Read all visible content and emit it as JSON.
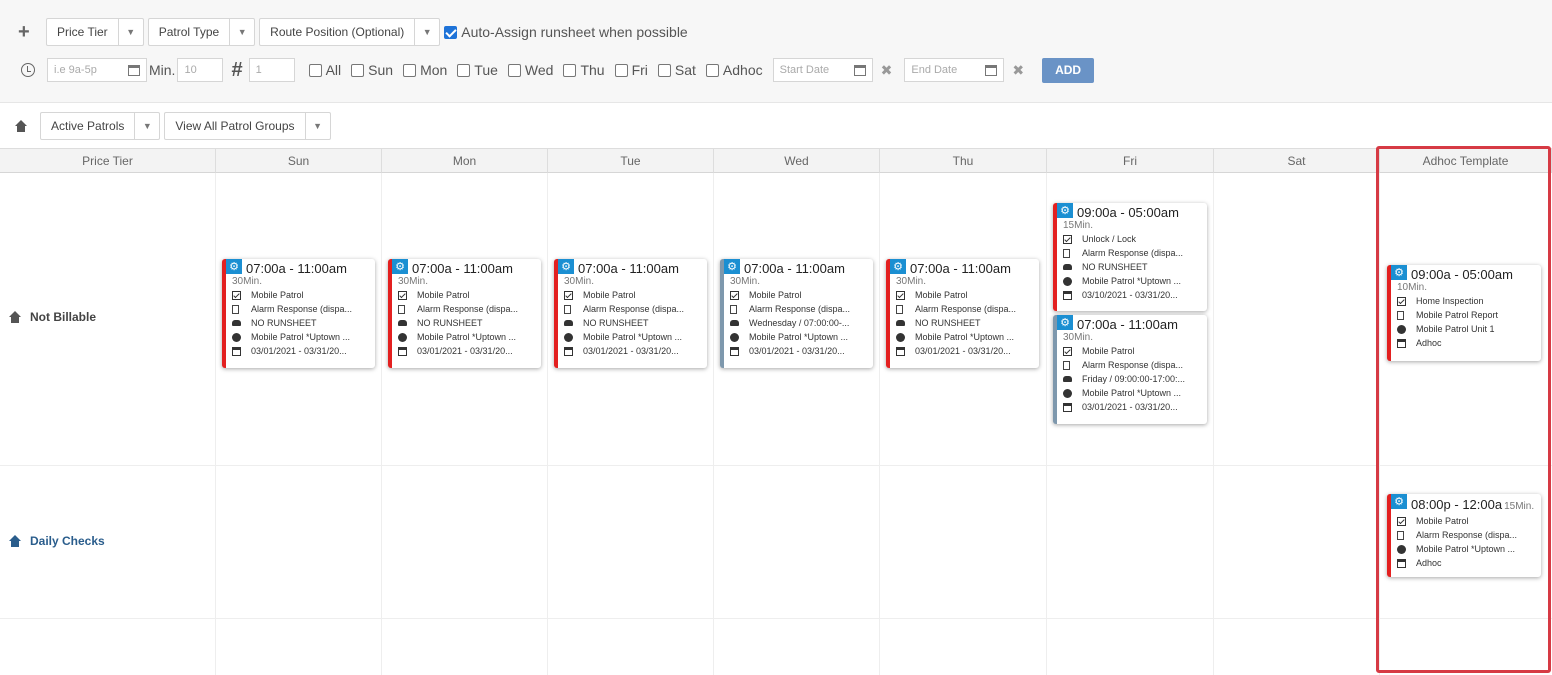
{
  "toolbar": {
    "add_icon": "plus-icon",
    "price_tier": "Price Tier",
    "patrol_type": "Patrol Type",
    "route_position": "Route Position (Optional)",
    "auto_assign": "Auto-Assign runsheet when possible",
    "time_placeholder": "i.e 9a-5p",
    "min_label": "Min.",
    "min_value": "10",
    "count_value": "1",
    "days": [
      "All",
      "Sun",
      "Mon",
      "Tue",
      "Wed",
      "Thu",
      "Fri",
      "Sat",
      "Adhoc"
    ],
    "start_date": "Start Date",
    "end_date": "End Date",
    "add_label": "ADD"
  },
  "filters": {
    "active": "Active Patrols",
    "groups": "View All Patrol Groups"
  },
  "grid": {
    "headers": [
      "Price Tier",
      "Sun",
      "Mon",
      "Tue",
      "Wed",
      "Thu",
      "Fri",
      "Sat",
      "Adhoc Template"
    ],
    "rows": [
      "Not Billable",
      "Daily Checks"
    ]
  },
  "colors": {
    "red_bar": "#e32020",
    "grey_bar": "#7e98ad",
    "gear_blue": "#1b8fd2",
    "highlight": "#d63a44",
    "add_button": "#6a93c6"
  },
  "cards": [
    {
      "time": "07:00a - 11:00am",
      "min": "30Min.",
      "lines": [
        "Mobile Patrol",
        "Alarm Response (dispa...",
        "NO RUNSHEET",
        "Mobile Patrol *Uptown ...",
        "03/01/2021 - 03/31/20..."
      ]
    },
    {
      "time": "07:00a - 11:00am",
      "min": "30Min.",
      "lines": [
        "Mobile Patrol",
        "Alarm Response (dispa...",
        "NO RUNSHEET",
        "Mobile Patrol *Uptown ...",
        "03/01/2021 - 03/31/20..."
      ]
    },
    {
      "time": "07:00a - 11:00am",
      "min": "30Min.",
      "lines": [
        "Mobile Patrol",
        "Alarm Response (dispa...",
        "NO RUNSHEET",
        "Mobile Patrol *Uptown ...",
        "03/01/2021 - 03/31/20..."
      ]
    },
    {
      "time": "07:00a - 11:00am",
      "min": "30Min.",
      "lines": [
        "Mobile Patrol",
        "Alarm Response (dispa...",
        "Wednesday / 07:00:00-...",
        "Mobile Patrol *Uptown ...",
        "03/01/2021 - 03/31/20..."
      ]
    },
    {
      "time": "07:00a - 11:00am",
      "min": "30Min.",
      "lines": [
        "Mobile Patrol",
        "Alarm Response (dispa...",
        "NO RUNSHEET",
        "Mobile Patrol *Uptown ...",
        "03/01/2021 - 03/31/20..."
      ]
    },
    {
      "time": "09:00a - 05:00am",
      "min": "15Min.",
      "lines": [
        "Unlock / Lock",
        "Alarm Response (dispa...",
        "NO RUNSHEET",
        "Mobile Patrol *Uptown ...",
        "03/10/2021 - 03/31/20..."
      ]
    },
    {
      "time": "07:00a - 11:00am",
      "min": "30Min.",
      "lines": [
        "Mobile Patrol",
        "Alarm Response (dispa...",
        "Friday / 09:00:00-17:00:...",
        "Mobile Patrol *Uptown ...",
        "03/01/2021 - 03/31/20..."
      ]
    },
    {
      "time": "09:00a - 05:00am",
      "min": "10Min.",
      "lines": [
        "Home Inspection",
        "Mobile Patrol Report",
        "Mobile Patrol Unit 1",
        "Adhoc"
      ]
    },
    {
      "time": "08:00p - 12:00a",
      "min": "15Min.",
      "lines": [
        "Mobile Patrol",
        "Alarm Response (dispa...",
        "Mobile Patrol *Uptown ...",
        "Adhoc"
      ]
    }
  ]
}
